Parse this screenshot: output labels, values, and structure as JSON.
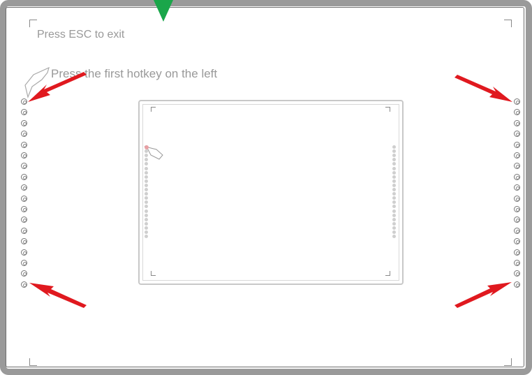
{
  "overlay": {
    "esc_hint": "Press ESC to exit",
    "instruction": "Press the first hotkey on the left"
  },
  "hotkeys": {
    "count": 17,
    "names": [
      "home-hotkey",
      "menu-hotkey",
      "back-hotkey",
      "forward-hotkey",
      "pen-hotkey",
      "play-hotkey",
      "pen-1-hotkey",
      "pen-2-hotkey",
      "pen-3-hotkey",
      "pen-4-hotkey",
      "highlighter-hotkey",
      "eraser-hotkey",
      "select-hotkey",
      "zoom-hotkey",
      "clear-hotkey",
      "keyboard-hotkey",
      "add-hotkey",
      "power-hotkey"
    ]
  },
  "colors": {
    "arrow": "#e0191f",
    "marker": "#1aa64a",
    "frame": "#9a9a9a",
    "text": "#999999"
  }
}
